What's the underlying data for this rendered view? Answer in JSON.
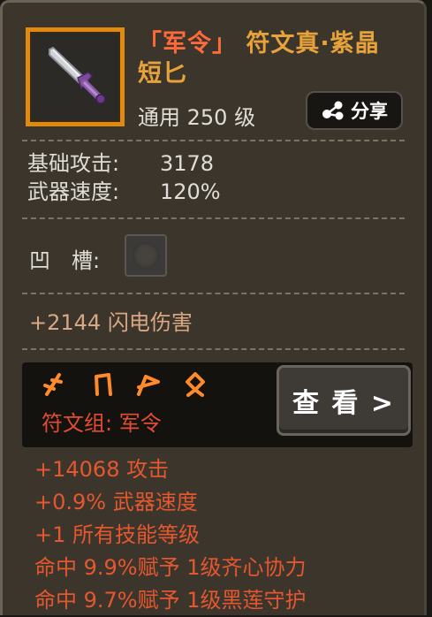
{
  "item": {
    "title_tag": "「军令」",
    "title_name": "符文真·紫晶短匕",
    "type": "通用",
    "level": "250 级"
  },
  "share": {
    "label": "分享",
    "icon": "share-icon"
  },
  "stats": [
    {
      "label": "基础攻击:",
      "value": "3178"
    },
    {
      "label": "武器速度:",
      "value": "120%"
    }
  ],
  "socket": {
    "label": "凹　槽:"
  },
  "bonus": "+2144 闪电伤害",
  "runeset": {
    "label": "符文组:  军令",
    "view_button": "查 看 >",
    "runes": [
      "rune-1-icon",
      "rune-2-icon",
      "rune-3-icon",
      "rune-4-icon"
    ],
    "color": "#e5572f",
    "effects": [
      "+14068 攻击",
      "+0.9% 武器速度",
      "+1 所有技能等级",
      "命中 9.9%赋予 1级齐心协力",
      "命中 9.7%赋予 1级黑莲守护"
    ]
  },
  "colors": {
    "rarity_border": "#e08a10",
    "title": "#e8a23a",
    "tag": "#ff6a3a"
  }
}
